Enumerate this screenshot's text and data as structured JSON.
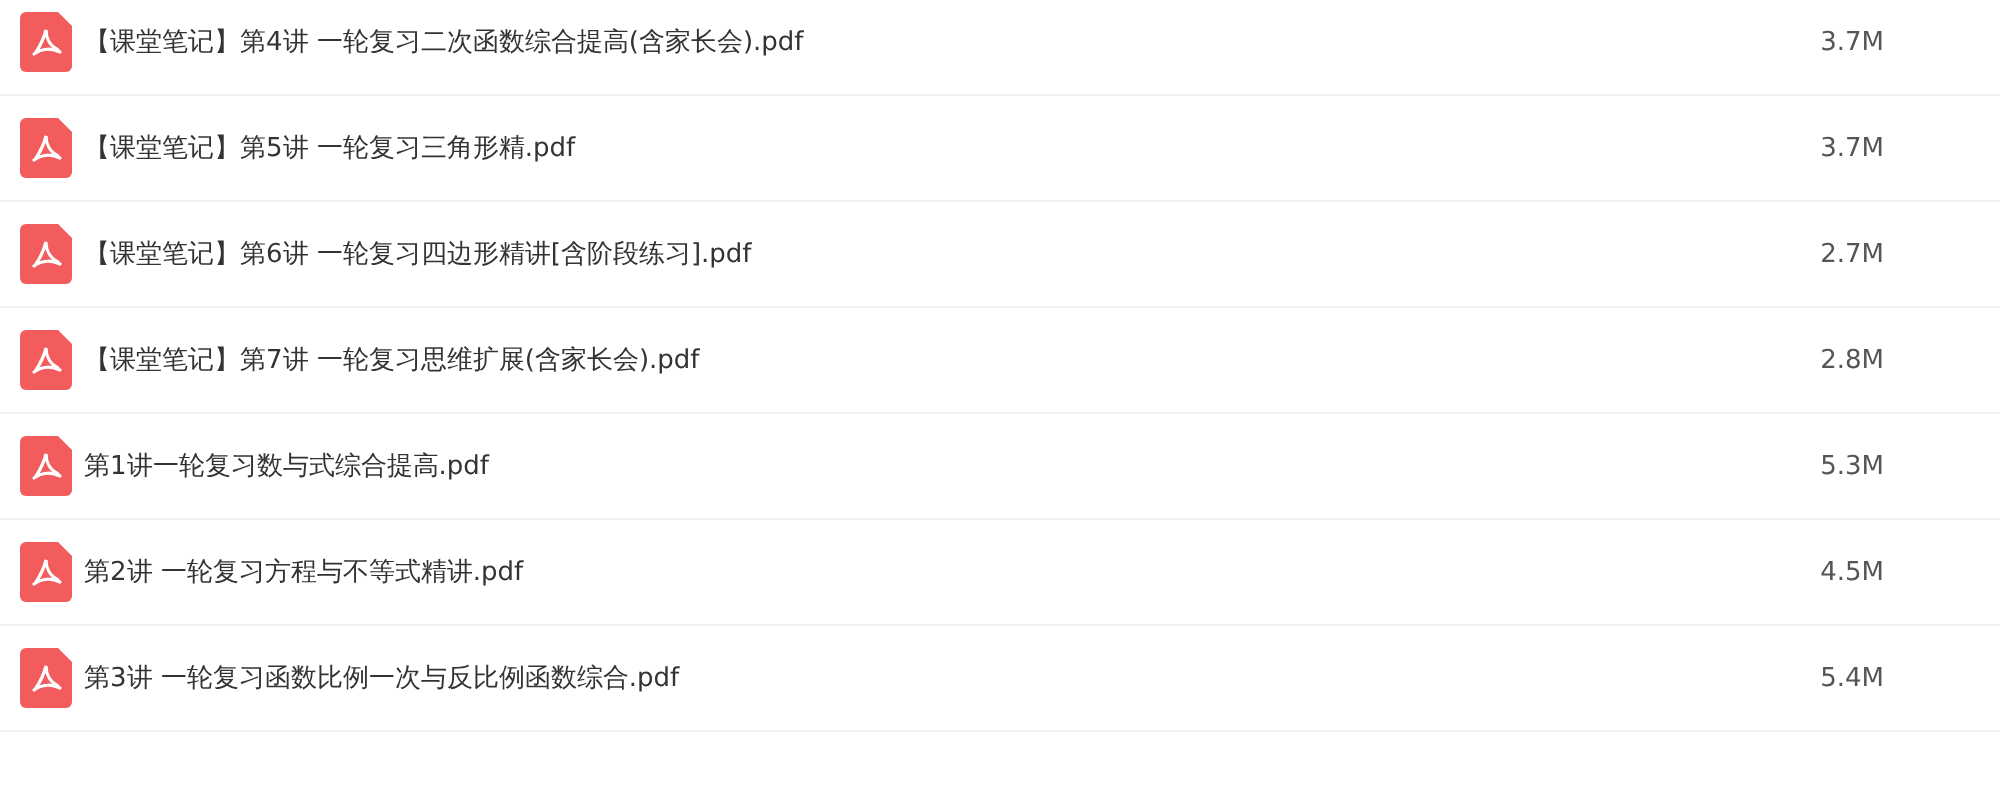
{
  "files": [
    {
      "name": "【课堂笔记】第4讲 一轮复习二次函数综合提高(含家长会).pdf",
      "size": "3.7M"
    },
    {
      "name": "【课堂笔记】第5讲 一轮复习三角形精.pdf",
      "size": "3.7M"
    },
    {
      "name": "【课堂笔记】第6讲 一轮复习四边形精讲[含阶段练习].pdf",
      "size": "2.7M"
    },
    {
      "name": "【课堂笔记】第7讲 一轮复习思维扩展(含家长会).pdf",
      "size": "2.8M"
    },
    {
      "name": "第1讲一轮复习数与式综合提高.pdf",
      "size": "5.3M"
    },
    {
      "name": "第2讲 一轮复习方程与不等式精讲.pdf",
      "size": "4.5M"
    },
    {
      "name": "第3讲 一轮复习函数比例一次与反比例函数综合.pdf",
      "size": "5.4M"
    }
  ]
}
